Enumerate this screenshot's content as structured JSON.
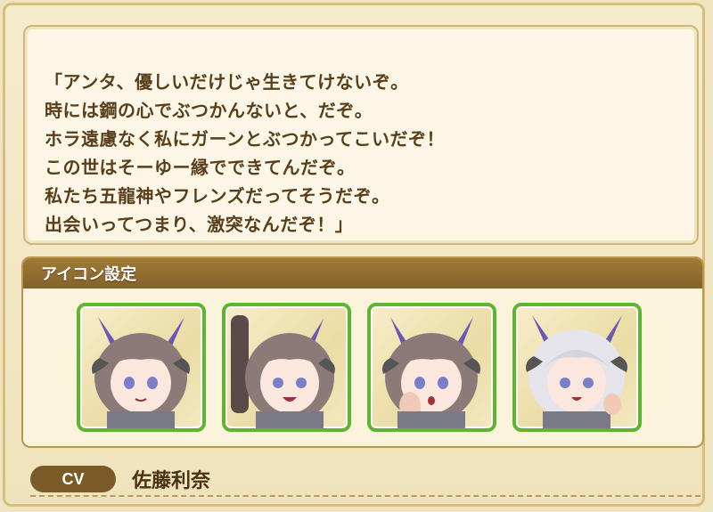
{
  "quote": {
    "lines": [
      "「アンタ、優しいだけじゃ生きてけないぞ。",
      "時には鋼の心でぶつかんないと、だぞ。",
      "ホラ遠慮なく私にガーンとぶつかってこいだぞ！",
      "この世はそーゆー縁でできてんだぞ。",
      "私たち五龍神やフレンズだってそうだぞ。",
      "出会いってつまり、激突なんだぞ！」"
    ]
  },
  "icon_settings": {
    "title": "アイコン設定",
    "icons": [
      {
        "expression": "smile",
        "hand": "none"
      },
      {
        "expression": "grin",
        "hand": "raised-arm"
      },
      {
        "expression": "surprised",
        "hand": "hand-on-cheek"
      },
      {
        "expression": "fierce",
        "hand": "claw-hand"
      }
    ]
  },
  "cv": {
    "label": "CV",
    "name": "佐藤利奈"
  },
  "colors": {
    "accent_brown": "#84612a",
    "icon_border_green": "#5eb52f",
    "text_brown": "#5a3e1a"
  }
}
